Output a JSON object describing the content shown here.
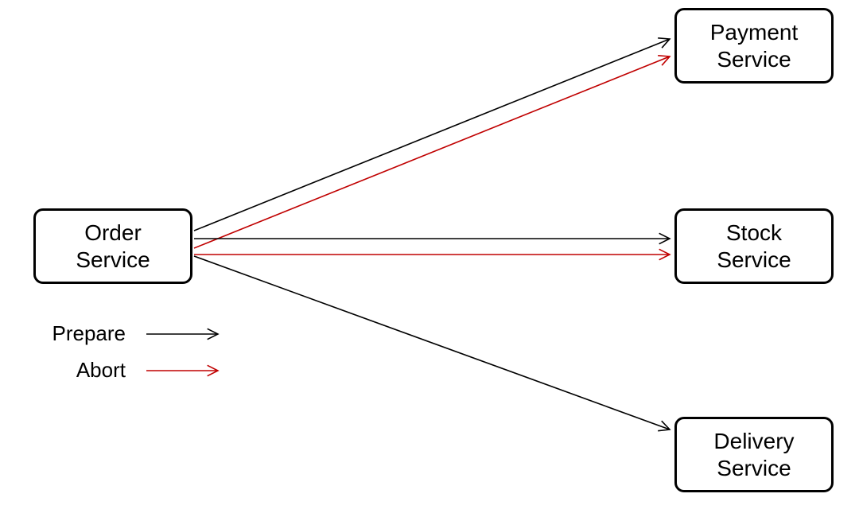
{
  "nodes": {
    "order": {
      "label": "Order\nService"
    },
    "payment": {
      "label": "Payment\nService"
    },
    "stock": {
      "label": "Stock\nService"
    },
    "delivery": {
      "label": "Delivery\nService"
    }
  },
  "legend": {
    "prepare": {
      "label": "Prepare",
      "color": "#000000"
    },
    "abort": {
      "label": "Abort",
      "color": "#C00000"
    }
  },
  "edges": [
    {
      "from": "order",
      "to": "payment",
      "type": "prepare"
    },
    {
      "from": "order",
      "to": "payment",
      "type": "abort"
    },
    {
      "from": "order",
      "to": "stock",
      "type": "prepare"
    },
    {
      "from": "order",
      "to": "stock",
      "type": "abort"
    },
    {
      "from": "order",
      "to": "delivery",
      "type": "prepare"
    }
  ]
}
